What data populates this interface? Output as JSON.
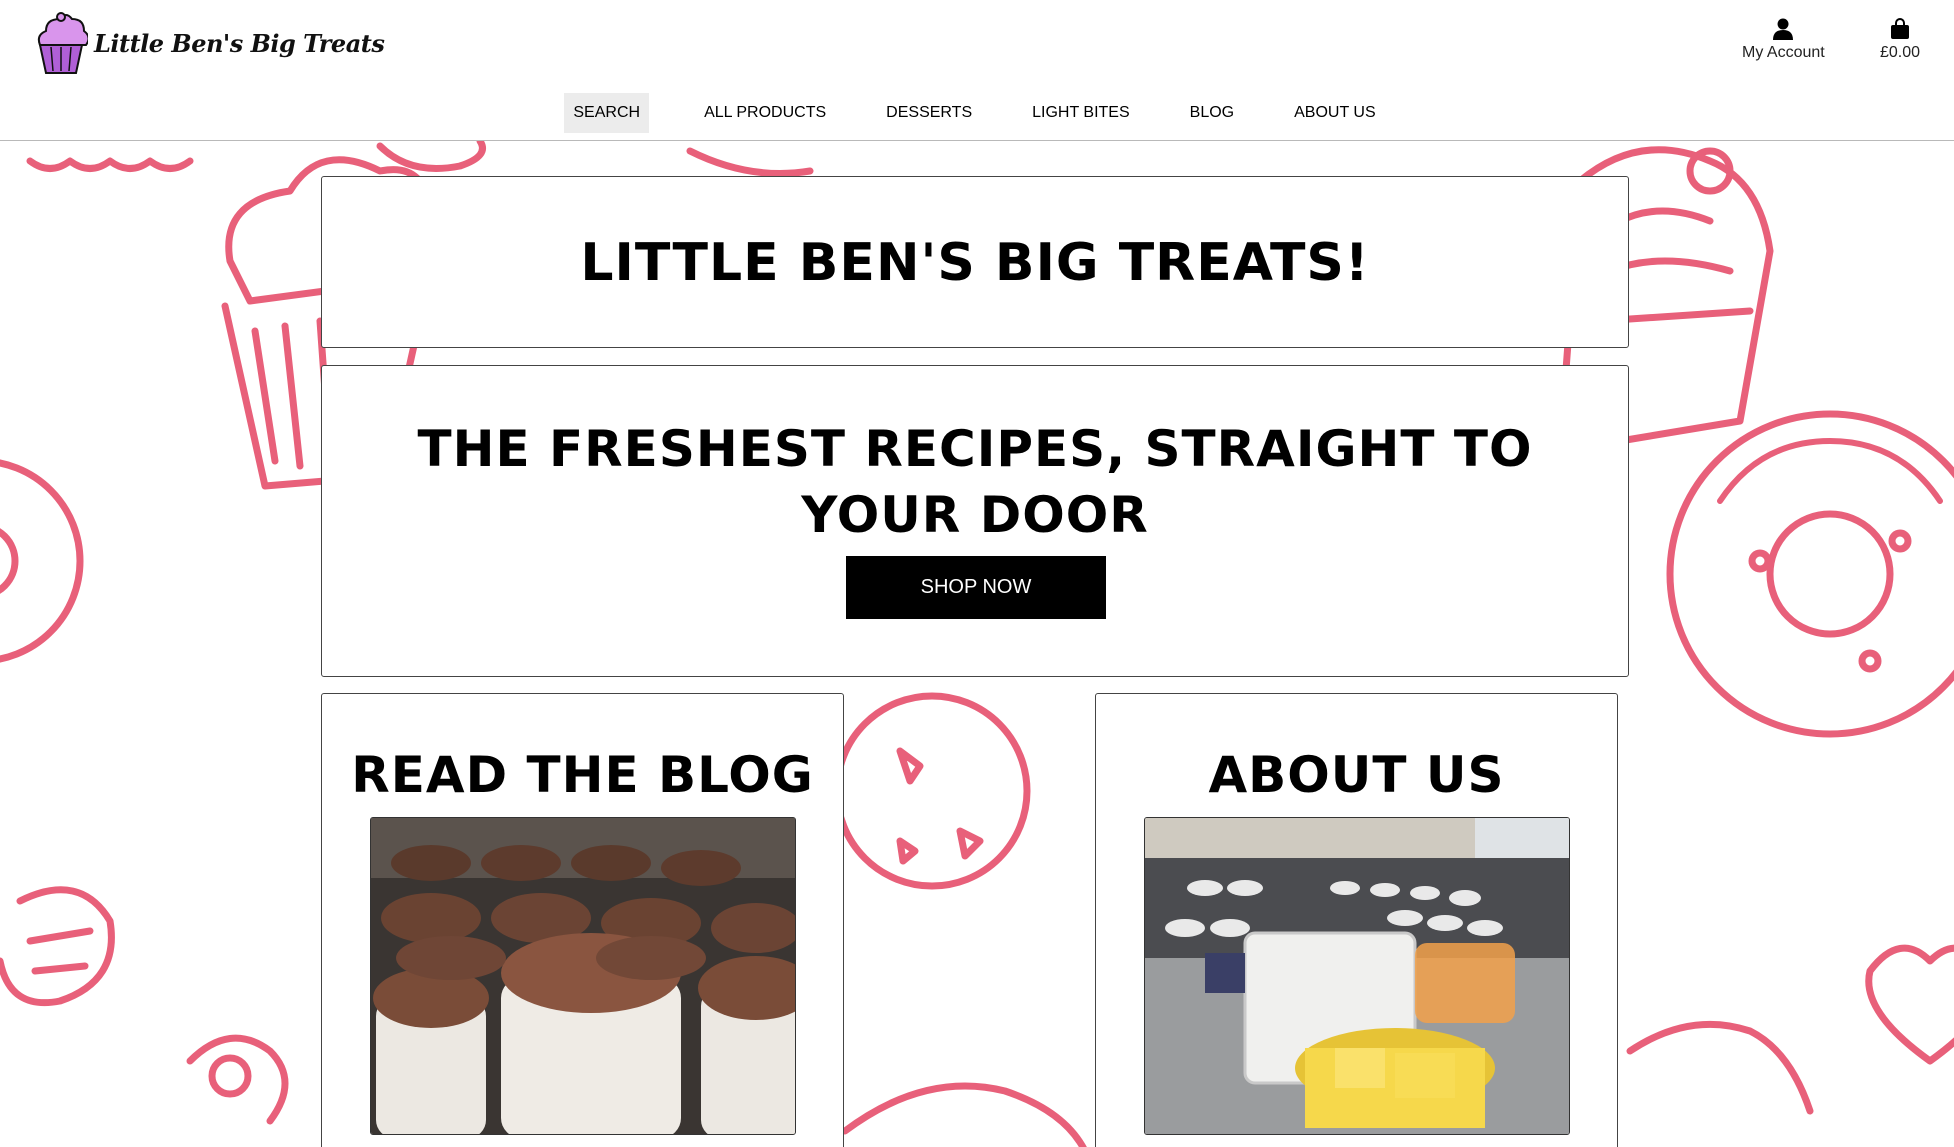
{
  "header": {
    "logo_text": "Little Ben's Big Treats",
    "account_label": "My Account",
    "cart_total": "£0.00"
  },
  "nav": {
    "items": [
      "SEARCH",
      "ALL PRODUCTS",
      "DESSERTS",
      "LIGHT BITES",
      "BLOG",
      "ABOUT US"
    ]
  },
  "hero": {
    "title": "LITTLE BEN'S BIG TREATS!",
    "tagline": "THE FRESHEST RECIPES, STRAIGHT TO YOUR DOOR",
    "cta": "SHOP NOW"
  },
  "sections": {
    "blog_title": "READ THE BLOG",
    "about_title": "ABOUT US"
  },
  "colors": {
    "accent_pink": "#e8607a",
    "logo_purple": "#c98ae6",
    "button_black": "#000000"
  },
  "icons": [
    "cupcake-logo-icon",
    "user-icon",
    "shopping-bag-icon"
  ]
}
